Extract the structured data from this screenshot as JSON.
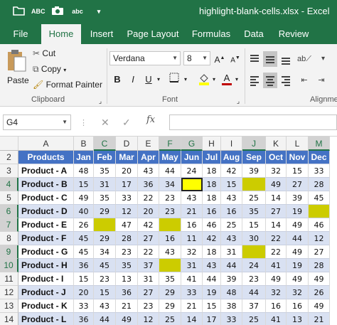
{
  "window": {
    "title": "highlight-blank-cells.xlsx  -  Excel",
    "accent": "#217346"
  },
  "qat": [
    "folder-open-icon",
    "spelling-icon",
    "camera-icon",
    "spelling-icon",
    "customize-qat-icon"
  ],
  "qat_text": {
    "abc1": "ABC",
    "abc2": "abc"
  },
  "tabs": [
    "File",
    "Home",
    "Insert",
    "Page Layout",
    "Formulas",
    "Data",
    "Review"
  ],
  "ribbon": {
    "clipboard": {
      "paste": "Paste",
      "cut": "Cut",
      "copy": "Copy",
      "format_painter": "Format Painter",
      "group": "Clipboard"
    },
    "font": {
      "name": "Verdana",
      "size": "8",
      "bold": "B",
      "italic": "I",
      "underline": "U",
      "group": "Font"
    },
    "alignment": {
      "group": "Alignme"
    }
  },
  "formula_bar": {
    "name_box": "G4",
    "fx": "fx",
    "cancel": "✕",
    "enter": "✓",
    "value": ""
  },
  "columns": [
    "A",
    "B",
    "C",
    "D",
    "E",
    "F",
    "G",
    "H",
    "I",
    "J",
    "K",
    "L",
    "M"
  ],
  "rows": [
    "2",
    "3",
    "4",
    "5",
    "6",
    "7",
    "8",
    "9",
    "10",
    "11",
    "12",
    "13",
    "14"
  ],
  "table": {
    "header": [
      "Products",
      "Jan",
      "Feb",
      "Mar",
      "Apr",
      "May",
      "Jun",
      "Jul",
      "Aug",
      "Sep",
      "Oct",
      "Nov",
      "Dec"
    ],
    "rows": [
      [
        "Product - A",
        "48",
        "35",
        "20",
        "43",
        "44",
        "24",
        "18",
        "42",
        "39",
        "32",
        "15",
        "33"
      ],
      [
        "Product - B",
        "15",
        "31",
        "17",
        "36",
        "34",
        "",
        "18",
        "15",
        "",
        "49",
        "27",
        "28"
      ],
      [
        "Product - C",
        "49",
        "35",
        "33",
        "22",
        "23",
        "43",
        "18",
        "43",
        "25",
        "14",
        "39",
        "45"
      ],
      [
        "Product - D",
        "40",
        "29",
        "12",
        "20",
        "23",
        "21",
        "16",
        "16",
        "35",
        "27",
        "19",
        ""
      ],
      [
        "Product - E",
        "26",
        "",
        "47",
        "42",
        "",
        "16",
        "46",
        "25",
        "15",
        "14",
        "49",
        "46"
      ],
      [
        "Product - F",
        "45",
        "29",
        "28",
        "27",
        "16",
        "11",
        "42",
        "43",
        "30",
        "22",
        "44",
        "12"
      ],
      [
        "Product - G",
        "45",
        "34",
        "23",
        "22",
        "43",
        "32",
        "18",
        "31",
        "",
        "22",
        "49",
        "27"
      ],
      [
        "Product - H",
        "36",
        "45",
        "35",
        "37",
        "",
        "31",
        "43",
        "44",
        "24",
        "41",
        "19",
        "28"
      ],
      [
        "Product - I",
        "15",
        "23",
        "13",
        "31",
        "35",
        "41",
        "44",
        "39",
        "23",
        "49",
        "49",
        "49"
      ],
      [
        "Product - J",
        "20",
        "15",
        "36",
        "27",
        "29",
        "33",
        "19",
        "48",
        "44",
        "32",
        "32",
        "26"
      ],
      [
        "Product - K",
        "33",
        "43",
        "21",
        "23",
        "29",
        "21",
        "15",
        "38",
        "37",
        "16",
        "16",
        "49"
      ],
      [
        "Product - L",
        "36",
        "44",
        "49",
        "12",
        "25",
        "14",
        "17",
        "33",
        "25",
        "41",
        "13",
        "21"
      ]
    ]
  },
  "colors": {
    "header_fill": "#4472c4",
    "band_fill": "#d9e1f2",
    "blank_fill": "#cccc00",
    "active_fill": "#ffff00"
  },
  "active_cell": "G4"
}
